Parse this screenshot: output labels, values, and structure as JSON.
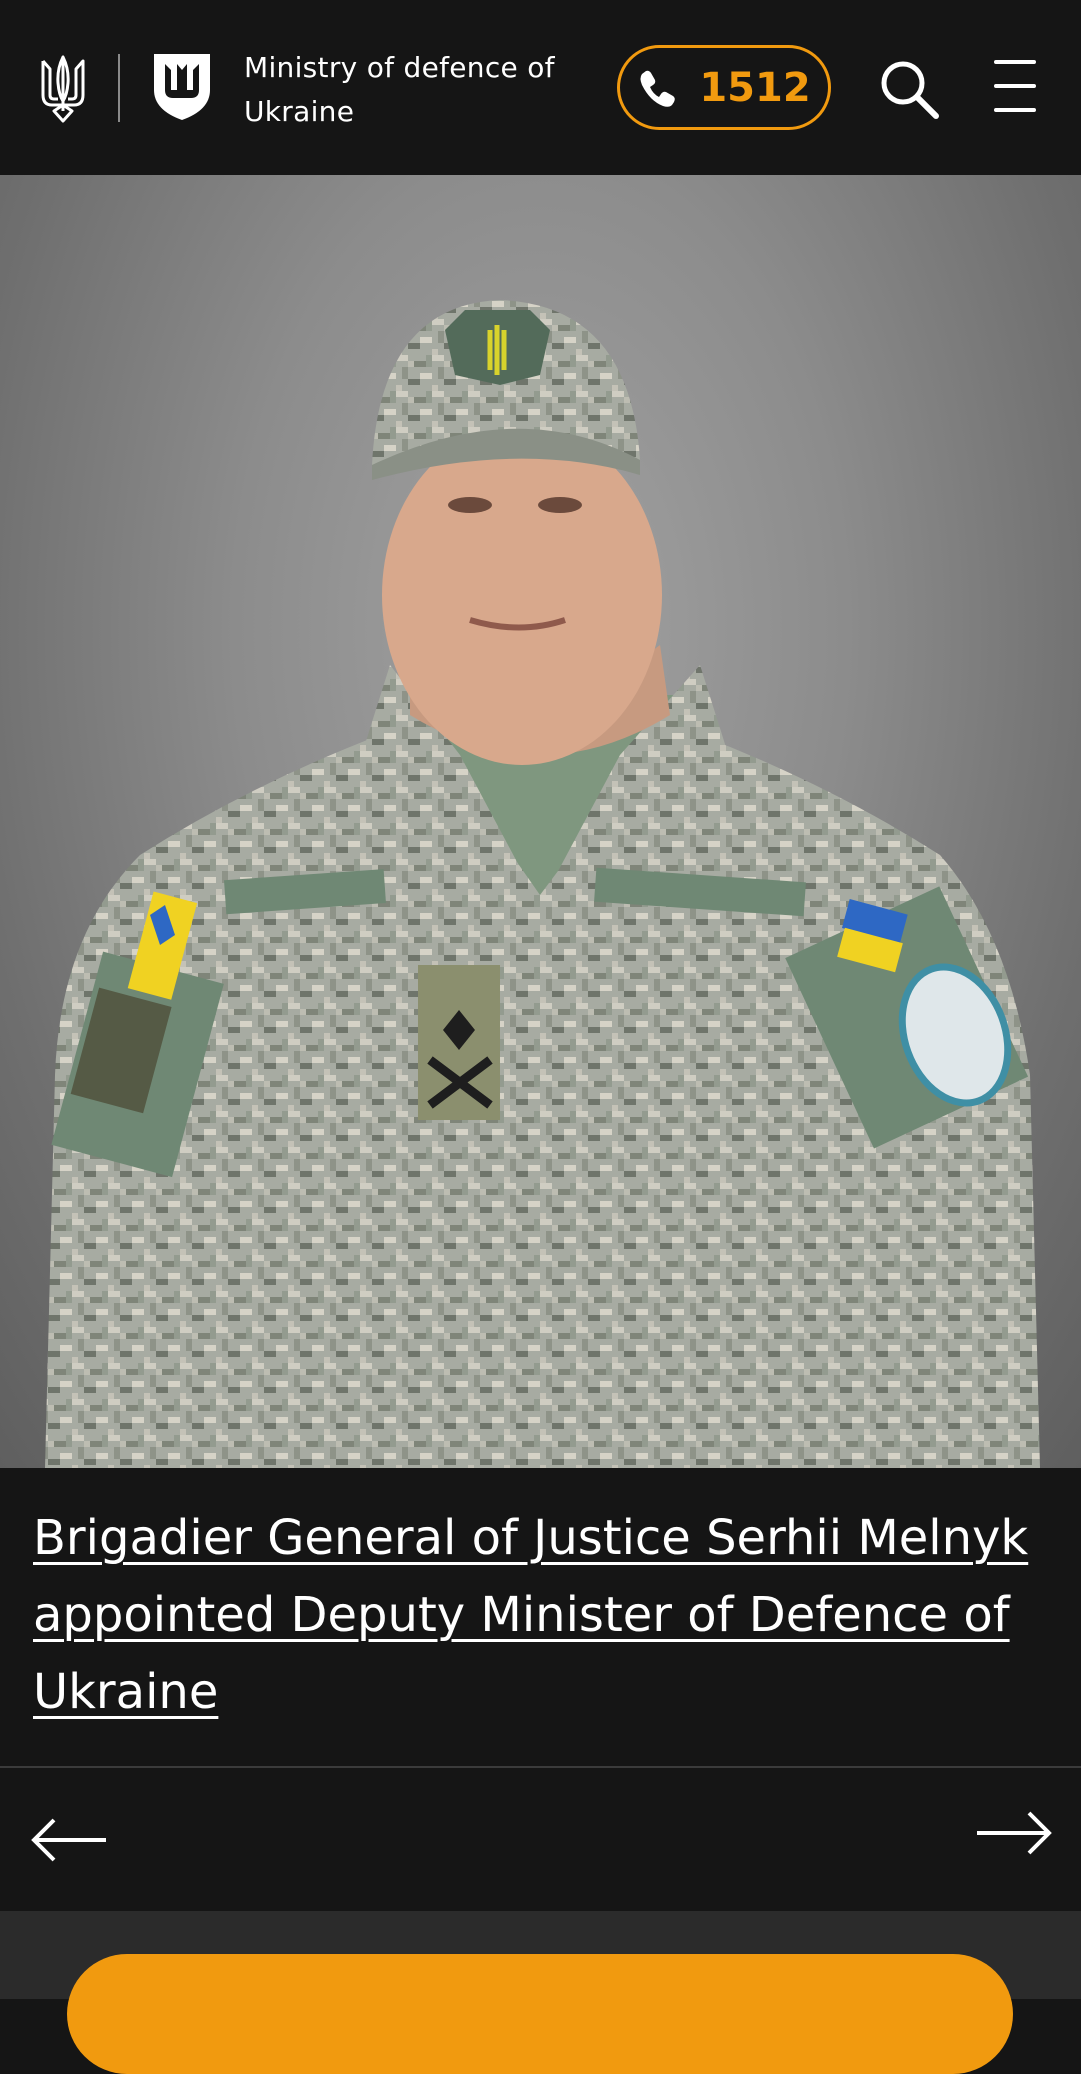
{
  "header": {
    "ministry_title": "Ministry of defence of Ukraine",
    "hotline_number": "1512",
    "icons": {
      "trident": "trident-icon",
      "emblem": "ministry-emblem-icon",
      "phone": "phone-icon",
      "search": "search-icon",
      "menu": "menu-icon"
    }
  },
  "hero": {
    "article_title": "Brigadier General of Justice Serhii Melnyk appointed Deputy Minister of Defence of Ukraine"
  },
  "navigation": {
    "prev_icon": "arrow-left-icon",
    "next_icon": "arrow-right-icon"
  },
  "colors": {
    "accent": "#f19a0f",
    "background": "#151515",
    "text": "#ffffff"
  }
}
